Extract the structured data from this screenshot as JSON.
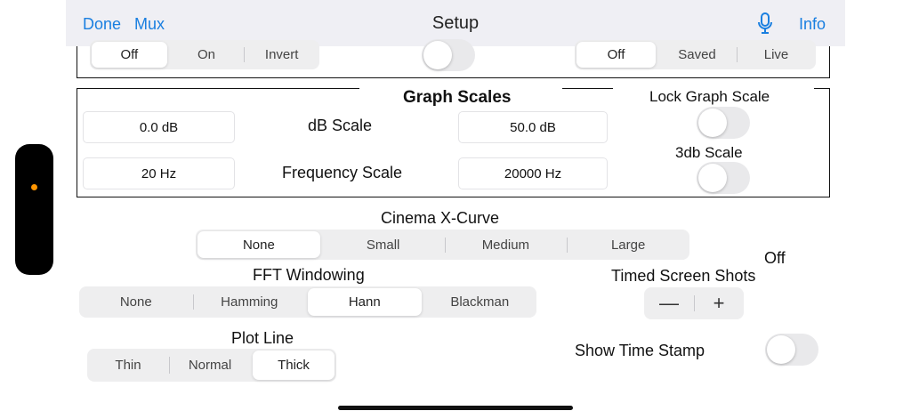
{
  "nav": {
    "done": "Done",
    "mux": "Mux",
    "title": "Setup",
    "info": "Info",
    "mic_icon": "microphone-icon"
  },
  "top": {
    "left_seg": {
      "options": [
        "Off",
        "On",
        "Invert"
      ],
      "selected": "Off"
    },
    "right_seg": {
      "options": [
        "Off",
        "Saved",
        "Live"
      ],
      "selected": "Off"
    }
  },
  "graph_scales": {
    "title": "Graph Scales",
    "db_min": "0.0 dB",
    "db_label": "dB Scale",
    "db_max": "50.0 dB",
    "freq_min": "20 Hz",
    "freq_label": "Frequency Scale",
    "freq_max": "20000 Hz",
    "lock_label": "Lock Graph Scale",
    "db3_label": "3db Scale"
  },
  "cinema": {
    "label": "Cinema X-Curve",
    "options": [
      "None",
      "Small",
      "Medium",
      "Large"
    ],
    "selected": "None"
  },
  "fft": {
    "label": "FFT Windowing",
    "options": [
      "None",
      "Hamming",
      "Hann",
      "Blackman"
    ],
    "selected": "Hann"
  },
  "timed": {
    "label": "Timed Screen Shots",
    "value": "Off",
    "minus": "—",
    "plus": "+"
  },
  "plot": {
    "label": "Plot Line",
    "options": [
      "Thin",
      "Normal",
      "Thick"
    ],
    "selected": "Thick"
  },
  "timestamp": {
    "label": "Show Time Stamp"
  },
  "colors": {
    "accent": "#1a7fe0",
    "indicator": "#ff9500"
  }
}
